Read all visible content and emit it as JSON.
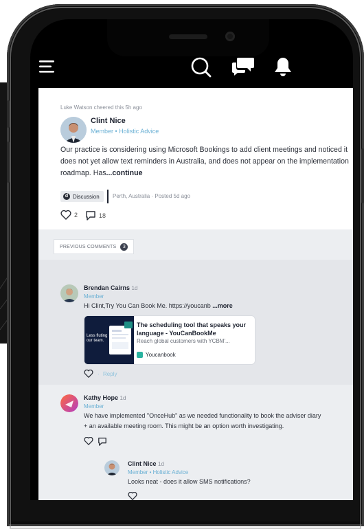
{
  "app": {
    "topbar_icons": [
      "menu-icon",
      "search-icon",
      "chat-icon",
      "bell-icon"
    ]
  },
  "post": {
    "activity": "Luke Watson cheered this 5h ago",
    "author": "Clint Nice",
    "role": "Member",
    "group": "Holistic Advice",
    "body": "Our practice is considering using Microsoft Bookings to add client meetings and noticed it does not yet allow text reminders in Australia, and does not appear on the implementation roadmap. Has",
    "continue_label": "...continue",
    "tag": "Discussion",
    "location": "Perth, Australia",
    "posted": "Posted 5d ago",
    "likes": "2",
    "comments": "18"
  },
  "previous_comments": {
    "label": "PREVIOUS COMMENTS",
    "count": "3"
  },
  "comments": [
    {
      "author": "Brendan Cairns",
      "time": "1d",
      "role": "Member",
      "text": "Hi Clint,Try You Can Book Me. https://youcanb",
      "more_label": "...more",
      "reply_label": "Reply",
      "link_preview": {
        "title": "The scheduling tool that speaks your language - YouCanBookMe",
        "description": "Reach global customers with YCBM'...",
        "source": "Youcanbook",
        "thumb_text": "Less fluting our team."
      }
    },
    {
      "author": "Kathy Hope",
      "time": "1d",
      "role": "Member",
      "text_line1": "We have implemented \"OnceHub\" as we needed functionality to book the adviser diary",
      "text_line2": "+ an available meeting room. This might be an option worth investigating."
    },
    {
      "author": "Clint Nice",
      "time": "1d",
      "role": "Member",
      "group": "Holistic Advice",
      "text": "Looks neat - does it allow SMS notifications?"
    }
  ],
  "colors": {
    "accent": "#6ab0d4",
    "phone_body": "#111111",
    "feed_bg": "#eceef1"
  }
}
